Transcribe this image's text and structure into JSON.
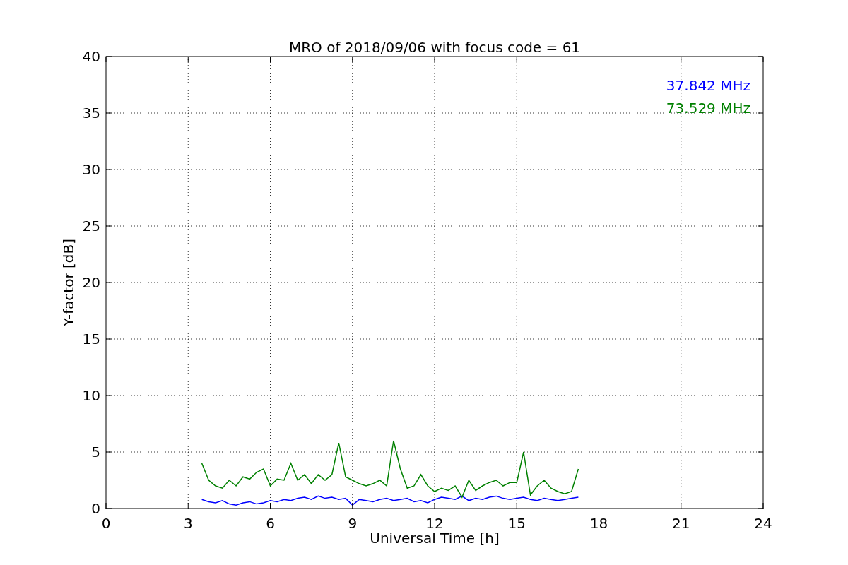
{
  "chart_data": {
    "type": "line",
    "title": "MRO of 2018/09/06 with focus code = 61",
    "xlabel": "Universal Time [h]",
    "ylabel": "Y-factor [dB]",
    "x": [
      3.5,
      3.75,
      4,
      4.25,
      4.5,
      4.75,
      5,
      5.25,
      5.5,
      5.75,
      6,
      6.25,
      6.5,
      6.75,
      7,
      7.25,
      7.5,
      7.75,
      8,
      8.25,
      8.5,
      8.75,
      9,
      9.25,
      9.5,
      9.75,
      10,
      10.25,
      10.5,
      10.75,
      11,
      11.25,
      11.5,
      11.75,
      12,
      12.25,
      12.5,
      12.75,
      13,
      13.25,
      13.5,
      13.75,
      14,
      14.25,
      14.5,
      14.75,
      15,
      15.25,
      15.5,
      15.75,
      16,
      16.25,
      16.5,
      16.75,
      17,
      17.25
    ],
    "series": [
      {
        "name": "37.842 MHz",
        "color": "#0000ff",
        "values": [
          0.8,
          0.6,
          0.5,
          0.7,
          0.4,
          0.3,
          0.5,
          0.6,
          0.4,
          0.5,
          0.7,
          0.6,
          0.8,
          0.7,
          0.9,
          1.0,
          0.8,
          1.1,
          0.9,
          1.0,
          0.8,
          0.9,
          0.3,
          0.8,
          0.7,
          0.6,
          0.8,
          0.9,
          0.7,
          0.8,
          0.9,
          0.6,
          0.7,
          0.5,
          0.8,
          1.0,
          0.9,
          0.8,
          1.1,
          0.7,
          0.9,
          0.8,
          1.0,
          1.1,
          0.9,
          0.8,
          0.9,
          1.0,
          0.8,
          0.7,
          0.9,
          0.8,
          0.7,
          0.8,
          0.9,
          1.0
        ]
      },
      {
        "name": "73.529 MHz",
        "color": "#008000",
        "values": [
          4.0,
          2.5,
          2.0,
          1.8,
          2.5,
          2.0,
          2.8,
          2.6,
          3.2,
          3.5,
          2.0,
          2.6,
          2.5,
          4.0,
          2.5,
          3.0,
          2.2,
          3.0,
          2.5,
          3.0,
          5.8,
          2.8,
          2.5,
          2.2,
          2.0,
          2.2,
          2.5,
          2.0,
          6.0,
          3.5,
          1.8,
          2.0,
          3.0,
          2.0,
          1.5,
          1.8,
          1.6,
          2.0,
          1.0,
          2.5,
          1.6,
          2.0,
          2.3,
          2.5,
          2.0,
          2.3,
          2.3,
          5.0,
          1.2,
          2.0,
          2.5,
          1.8,
          1.5,
          1.3,
          1.5,
          3.5
        ]
      }
    ],
    "grid": true,
    "xlim": [
      0,
      24
    ],
    "ylim": [
      0,
      40
    ],
    "xticks": [
      0,
      3,
      6,
      9,
      12,
      15,
      18,
      21,
      24
    ],
    "yticks": [
      0,
      5,
      10,
      15,
      20,
      25,
      30,
      35,
      40
    ]
  }
}
